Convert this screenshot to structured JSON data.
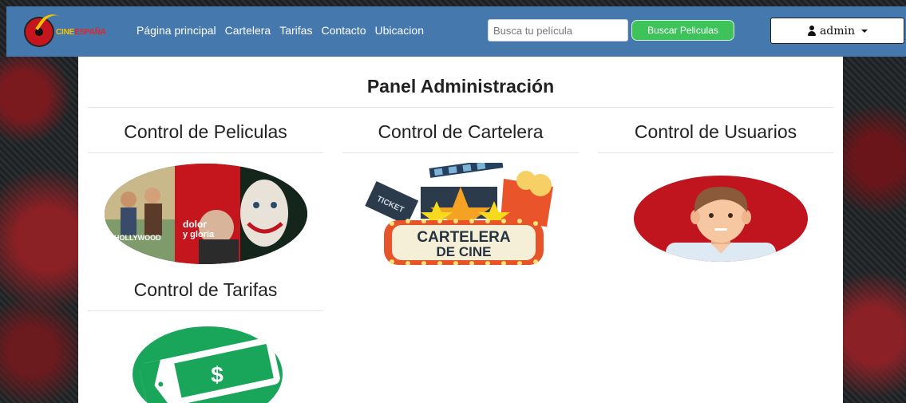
{
  "brand": {
    "part1": "CINE",
    "part2": "ESPAÑA"
  },
  "nav": {
    "links": [
      "Página principal",
      "Cartelera",
      "Tarifas",
      "Contacto",
      "Ubicacion"
    ]
  },
  "search": {
    "placeholder": "Busca tu película",
    "button_label": "Buscar Peliculas"
  },
  "user": {
    "name": "admin"
  },
  "panel": {
    "title": "Panel Administración",
    "sections": [
      {
        "title": "Control de Peliculas"
      },
      {
        "title": "Control de Cartelera"
      },
      {
        "title": "Control de Usuarios"
      },
      {
        "title": "Control de Tarifas"
      }
    ]
  },
  "posters": {
    "hollywood": "HOLLYWOOD",
    "dolor_line1": "dolor",
    "dolor_line2": "y gloria"
  },
  "cartelera_sign": {
    "line1": "CARTELERA",
    "line2": "DE CINE",
    "ticket": "TICKET"
  },
  "tarifa_symbol": "$",
  "colors": {
    "navbar": "#4578ac",
    "search_button": "#3ec35b",
    "tarifa_green": "#19a55a",
    "usuarios_red": "#c0151e"
  }
}
